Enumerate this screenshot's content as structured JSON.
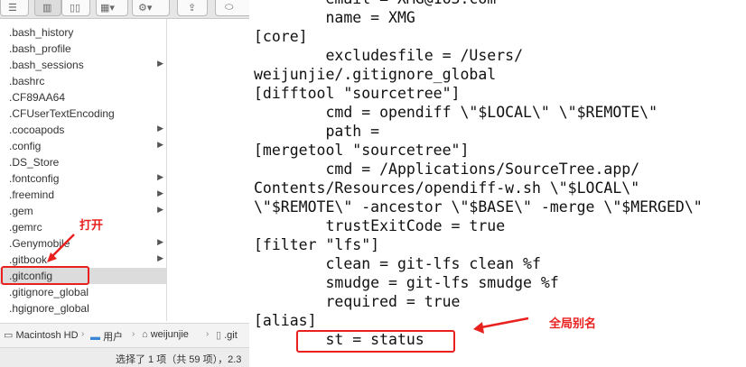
{
  "finder": {
    "files": [
      {
        "name": ".bash_history",
        "folder": false
      },
      {
        "name": ".bash_profile",
        "folder": false
      },
      {
        "name": ".bash_sessions",
        "folder": true
      },
      {
        "name": ".bashrc",
        "folder": false
      },
      {
        "name": ".CF89AA64",
        "folder": false
      },
      {
        "name": ".CFUserTextEncoding",
        "folder": false
      },
      {
        "name": ".cocoapods",
        "folder": true
      },
      {
        "name": ".config",
        "folder": true
      },
      {
        "name": ".DS_Store",
        "folder": false
      },
      {
        "name": ".fontconfig",
        "folder": true
      },
      {
        "name": ".freemind",
        "folder": true
      },
      {
        "name": ".gem",
        "folder": true
      },
      {
        "name": ".gemrc",
        "folder": false
      },
      {
        "name": ".Genymobile",
        "folder": true
      },
      {
        "name": ".gitbook",
        "folder": true
      },
      {
        "name": ".gitconfig",
        "folder": false,
        "selected": true
      },
      {
        "name": ".gitignore_global",
        "folder": false
      },
      {
        "name": ".hgignore_global",
        "folder": false
      }
    ],
    "path": {
      "disk": "Macintosh HD",
      "users": "用户",
      "home": "weijunjie",
      "file": ".git"
    },
    "status": "选择了 1 项（共 59 项），2.3"
  },
  "editor": {
    "lines": [
      "        email = XMG@163.com",
      "        name = XMG",
      "[core]",
      "        excludesfile = /Users/",
      "weijunjie/.gitignore_global",
      "[difftool \"sourcetree\"]",
      "        cmd = opendiff \\\"$LOCAL\\\" \\\"$REMOTE\\\"",
      "        path =",
      "[mergetool \"sourcetree\"]",
      "        cmd = /Applications/SourceTree.app/",
      "Contents/Resources/opendiff-w.sh \\\"$LOCAL\\\"",
      "\\\"$REMOTE\\\" -ancestor \\\"$BASE\\\" -merge \\\"$MERGED\\\"",
      "        trustExitCode = true",
      "[filter \"lfs\"]",
      "        clean = git-lfs clean %f",
      "        smudge = git-lfs smudge %f",
      "        required = true",
      "[alias]",
      "        st = status"
    ]
  },
  "annotations": {
    "open_label": "打开",
    "alias_label": "全局别名",
    "color": "#e8211f"
  },
  "icons": [
    "list-view-icon",
    "column-view-icon",
    "cover-flow-icon",
    "arrange-icon",
    "action-gear-icon",
    "share-icon",
    "tag-icon",
    "folder-icon",
    "home-icon",
    "document-icon"
  ]
}
